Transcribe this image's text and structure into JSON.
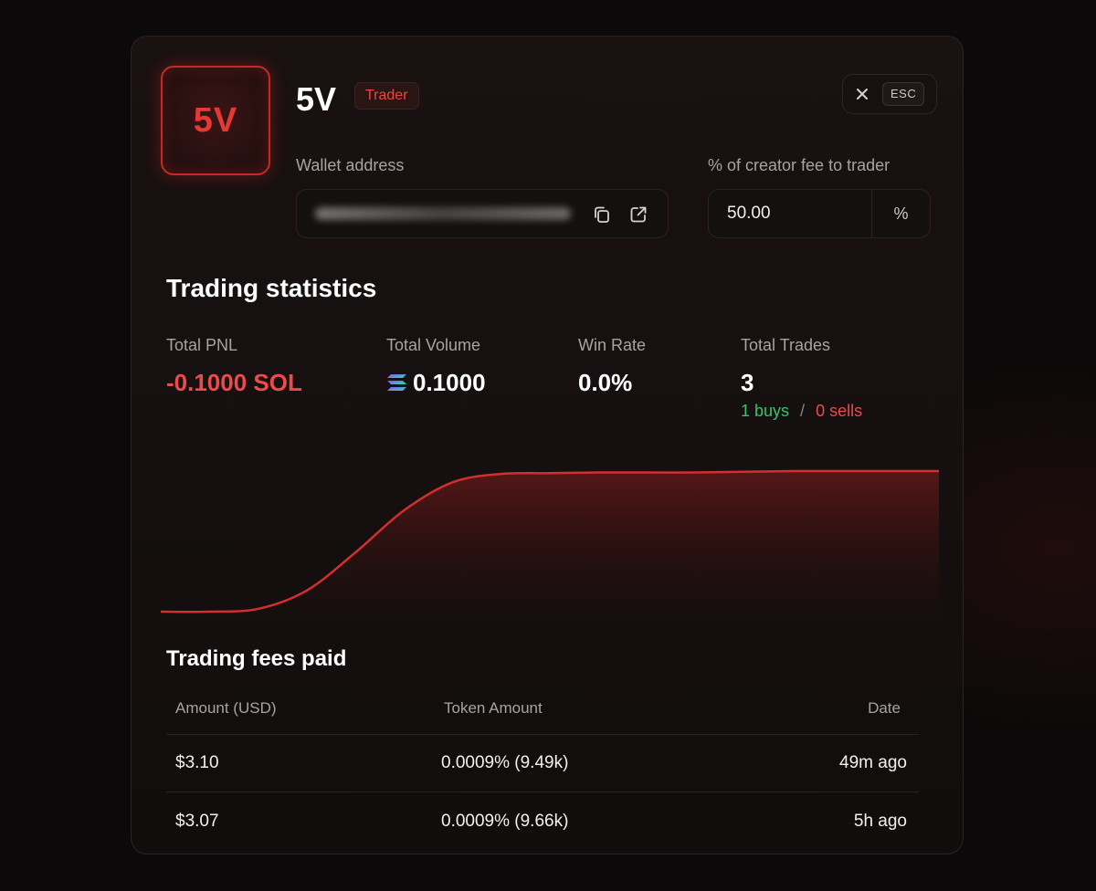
{
  "trader": {
    "initials": "5V",
    "name": "5V",
    "role": "Trader"
  },
  "close": {
    "icon": "close-icon",
    "key_label": "ESC"
  },
  "wallet": {
    "label": "Wallet address",
    "copy_icon": "copy-icon",
    "open_icon": "external-link-icon"
  },
  "creator_fee": {
    "label": "% of creator fee to trader",
    "value": "50.00",
    "unit": "%"
  },
  "trading_statistics": {
    "title": "Trading statistics",
    "total_pnl": {
      "label": "Total PNL",
      "value": "-0.1000 SOL"
    },
    "total_volume": {
      "label": "Total Volume",
      "value": "0.1000",
      "icon": "solana-icon"
    },
    "win_rate": {
      "label": "Win Rate",
      "value": "0.0%"
    },
    "total_trades": {
      "label": "Total Trades",
      "value": "3",
      "buys": "1 buys",
      "separator": "/",
      "sells": "0 sells"
    }
  },
  "chart_data": {
    "type": "area",
    "x": [
      0,
      1,
      2,
      3,
      4,
      5,
      6,
      7,
      8,
      9,
      10,
      11,
      12,
      13,
      14,
      15,
      16
    ],
    "values": [
      0,
      0,
      0.02,
      0.15,
      0.42,
      0.72,
      0.92,
      0.98,
      0.985,
      0.99,
      0.99,
      0.99,
      0.995,
      1.0,
      1.0,
      1.0,
      1.0
    ],
    "title": "",
    "xlabel": "",
    "ylabel": "",
    "grid": false,
    "colors": {
      "line": "#d32f2f",
      "fill": "#7a1a1a"
    }
  },
  "fees": {
    "title": "Trading fees paid",
    "columns": [
      "Amount (USD)",
      "Token Amount",
      "Date"
    ],
    "rows": [
      {
        "amount": "$3.10",
        "token_amount": "0.0009% (9.49k)",
        "date": "49m ago"
      },
      {
        "amount": "$3.07",
        "token_amount": "0.0009% (9.66k)",
        "date": "5h ago"
      }
    ]
  },
  "colors": {
    "accent": "#e53935",
    "negative": "#ef4a4a",
    "positive": "#33c46a",
    "background": "#0c0a0a",
    "panel": "#161010"
  }
}
